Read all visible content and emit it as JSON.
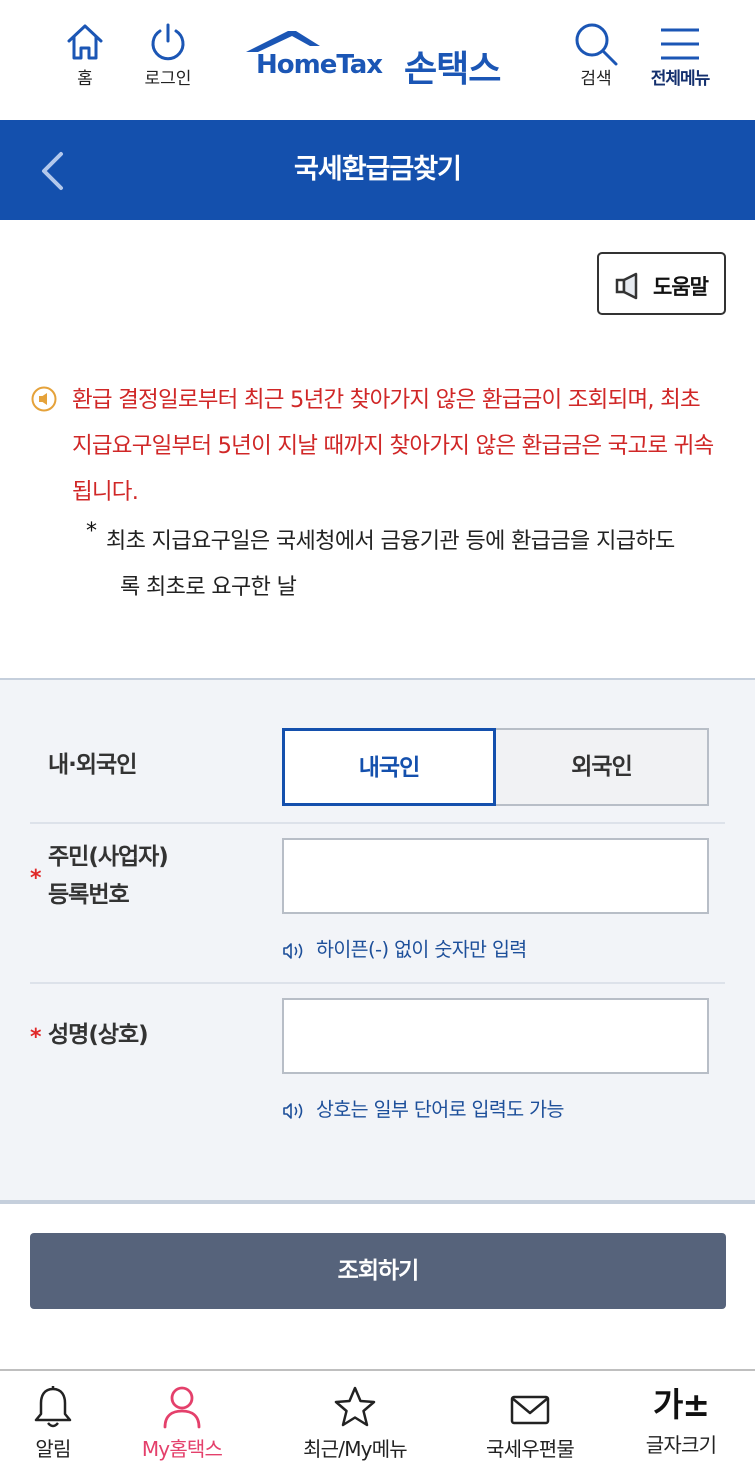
{
  "header": {
    "home_label": "홈",
    "login_label": "로그인",
    "logo_en": "HomeTax",
    "logo_ko": "손택스",
    "search_label": "검색",
    "menu_label": "전체메뉴"
  },
  "title_bar": {
    "title": "국세환급금찾기"
  },
  "help": {
    "label": "도움말"
  },
  "notice": {
    "text": "환급 결정일로부터 최근 5년간 찾아가지 않은 환급금이 조회되며, 최초 지급요구일부터 5년이 지날 때까지 찾아가지 않은 환급금은 국고로 귀속됩니다.",
    "note_star": "*",
    "note_line1": "최초 지급요구일은 국세청에서 금융기관 등에 환급금을 지급하도",
    "note_line2": "록 최초로 요구한 날"
  },
  "form": {
    "nationality": {
      "label": "내·외국인",
      "options": [
        "내국인",
        "외국인"
      ],
      "selected": "내국인"
    },
    "resident_number": {
      "label_line1": "주민(사업자)",
      "label_line2": "등록번호",
      "required_mark": "*",
      "value": "",
      "hint": "하이픈(-) 없이 숫자만 입력"
    },
    "name": {
      "label": "성명(상호)",
      "required_mark": "*",
      "value": "",
      "hint": "상호는 일부 단어로 입력도 가능"
    },
    "submit_label": "조회하기"
  },
  "bottom_nav": {
    "items": [
      {
        "label": "알림",
        "icon": "bell-icon"
      },
      {
        "label": "My홈택스",
        "icon": "user-icon",
        "active": true
      },
      {
        "label": "최근/My메뉴",
        "icon": "star-icon"
      },
      {
        "label": "국세우편물",
        "icon": "envelope-icon"
      },
      {
        "label": "글자크기",
        "icon": "font-size-icon",
        "glyph": "가±"
      }
    ]
  },
  "colors": {
    "primary": "#1450ad",
    "notice_red": "#d02727",
    "submit_bg": "#56637b",
    "active_nav": "#e4406b",
    "form_bg": "#f2f4f8"
  }
}
